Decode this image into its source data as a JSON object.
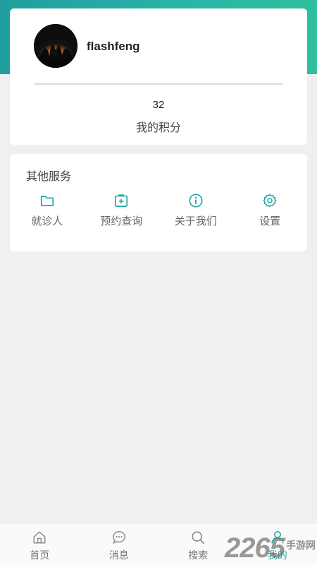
{
  "profile": {
    "username": "flashfeng",
    "points_value": "32",
    "points_label": "我的积分"
  },
  "services": {
    "title": "其他服务",
    "items": [
      {
        "label": "就诊人",
        "icon": "folder-icon"
      },
      {
        "label": "预约查询",
        "icon": "medical-kit-icon"
      },
      {
        "label": "关于我们",
        "icon": "info-icon"
      },
      {
        "label": "设置",
        "icon": "gear-icon"
      }
    ]
  },
  "tabbar": {
    "items": [
      {
        "label": "首页",
        "icon": "home-icon"
      },
      {
        "label": "消息",
        "icon": "chat-icon"
      },
      {
        "label": "搜索",
        "icon": "search-icon"
      },
      {
        "label": "我的",
        "icon": "user-icon",
        "active": true
      }
    ]
  },
  "watermark": {
    "number": "2265",
    "text": "手游网"
  },
  "colors": {
    "accent": "#1fa7a4",
    "header_gradient_start": "#1f9e9f",
    "header_gradient_end": "#2fbf9c",
    "background": "#f0f0f0"
  }
}
